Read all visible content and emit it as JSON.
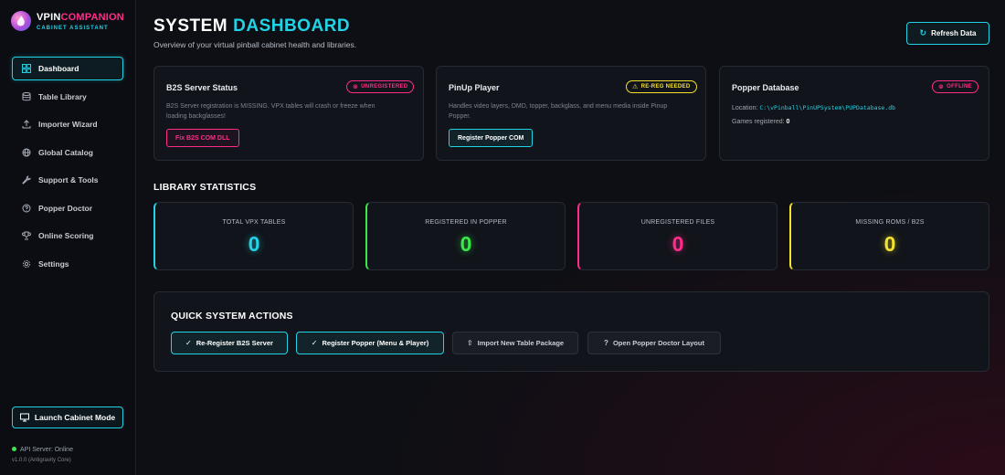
{
  "brand": {
    "name_part1": "VPIN",
    "name_part2": "COMPANION",
    "subtitle": "CABINET ASSISTANT"
  },
  "sidebar": {
    "items": [
      {
        "label": "Dashboard",
        "icon": "grid-icon",
        "active": true
      },
      {
        "label": "Table Library",
        "icon": "database-icon"
      },
      {
        "label": "Importer Wizard",
        "icon": "upload-icon"
      },
      {
        "label": "Global Catalog",
        "icon": "globe-icon"
      },
      {
        "label": "Support & Tools",
        "icon": "wrench-icon"
      },
      {
        "label": "Popper Doctor",
        "icon": "help-circle-icon"
      },
      {
        "label": "Online Scoring",
        "icon": "trophy-icon"
      },
      {
        "label": "Settings",
        "icon": "gear-icon"
      }
    ],
    "cabinet_button": "Launch Cabinet Mode",
    "api_status": "API Server: Online",
    "version": "v1.0.0 (Antigravity Core)"
  },
  "header": {
    "title_part1": "SYSTEM",
    "title_part2": "DASHBOARD",
    "subtitle": "Overview of your virtual pinball cabinet health and libraries.",
    "refresh_label": "Refresh Data"
  },
  "status_cards": {
    "b2s": {
      "title": "B2S Server Status",
      "badge": "UNREGISTERED",
      "desc_line1": "B2S Server registration is MISSING. VPX tables will crash or freeze when",
      "desc_line2": "loading backglasses!",
      "button": "Fix B2S COM DLL"
    },
    "pinup": {
      "title": "PinUp Player",
      "badge": "RE-REG NEEDED",
      "desc_line1": "Handles video layers, DMD, topper, backglass, and menu media inside Pinup",
      "desc_line2": "Popper.",
      "button": "Register Popper COM"
    },
    "popper_db": {
      "title": "Popper Database",
      "badge": "OFFLINE",
      "location_label": "Location:",
      "location_path": "C:\\vPinball\\PinUPSystem\\PUPDatabase.db",
      "games_label": "Games registered:",
      "games_value": "0"
    }
  },
  "stats": {
    "section_title": "LIBRARY STATISTICS",
    "items": [
      {
        "label": "TOTAL VPX TABLES",
        "value": "0"
      },
      {
        "label": "REGISTERED IN POPPER",
        "value": "0"
      },
      {
        "label": "UNREGISTERED FILES",
        "value": "0"
      },
      {
        "label": "MISSING ROMS / B2S",
        "value": "0"
      }
    ]
  },
  "quick_actions": {
    "title": "QUICK SYSTEM ACTIONS",
    "buttons": [
      {
        "label": "Re-Register B2S Server",
        "icon": "check-circle-icon"
      },
      {
        "label": "Register Popper (Menu & Player)",
        "icon": "check-circle-icon"
      },
      {
        "label": "Import New Table Package",
        "icon": "upload-icon"
      },
      {
        "label": "Open Popper Doctor Layout",
        "icon": "help-circle-icon"
      }
    ]
  },
  "colors": {
    "accent_cyan": "#22d3e6",
    "accent_pink": "#ff2d8a",
    "accent_green": "#39e84a",
    "accent_yellow": "#f5e22e",
    "background": "#0d0f14"
  }
}
